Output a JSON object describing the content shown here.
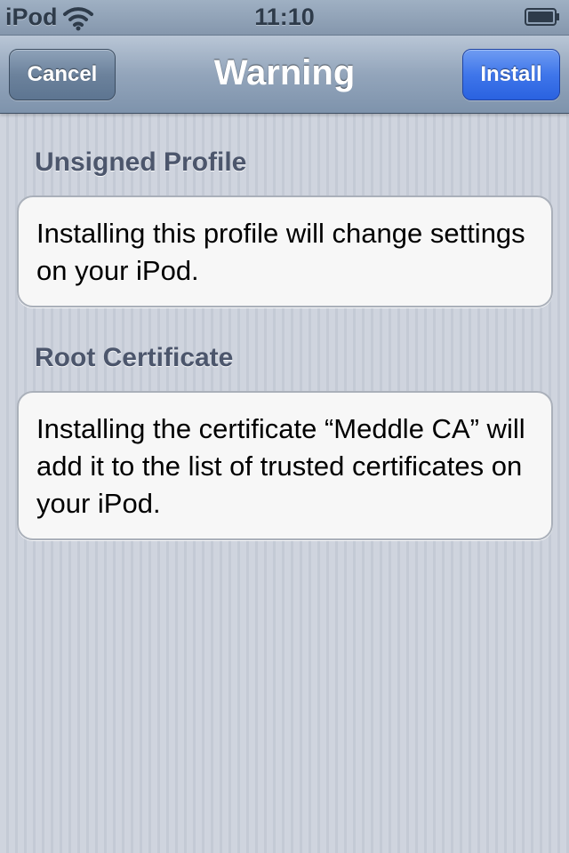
{
  "status_bar": {
    "carrier": "iPod",
    "time": "11:10",
    "wifi_icon": "wifi-icon",
    "battery_icon": "battery-icon"
  },
  "nav_bar": {
    "title": "Warning",
    "cancel_label": "Cancel",
    "install_label": "Install"
  },
  "sections": [
    {
      "header": "Unsigned Profile",
      "text": "Installing this profile will change settings on your iPod."
    },
    {
      "header": "Root Certificate",
      "text": "Installing the certificate “Meddle CA” will add it to the list of trusted certificates on your iPod."
    }
  ],
  "colors": {
    "install_button": "#3f76ea",
    "nav_bar": "#93a5bb",
    "section_header": "#4c566c",
    "background": "#c9cfd9"
  }
}
